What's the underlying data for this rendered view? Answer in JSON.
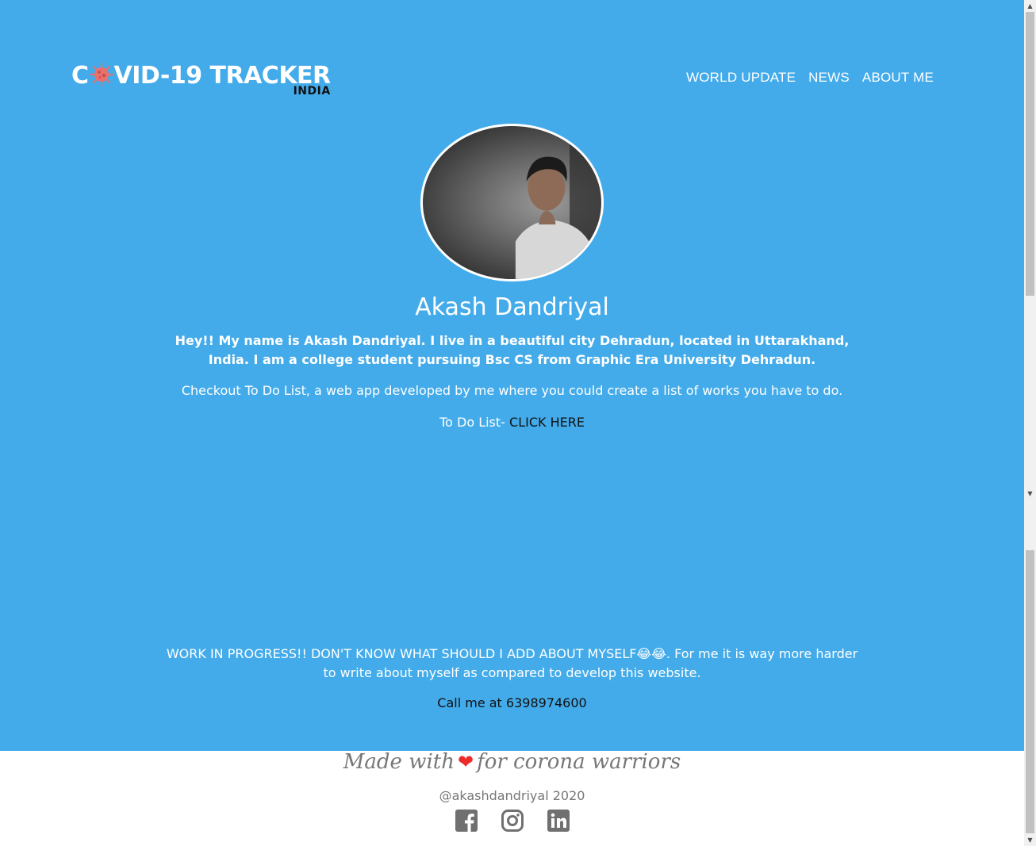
{
  "header": {
    "logo_part1": "C",
    "logo_part2": "VID-19 TRACKER",
    "logo_sub": "INDIA",
    "nav": [
      "WORLD UPDATE",
      "NEWS",
      "ABOUT ME"
    ]
  },
  "profile": {
    "name": "Akash Dandriyal",
    "intro": "Hey!! My name is Akash Dandriyal. I live in a beautiful city Dehradun, located in Uttarakhand, India. I am a college student pursuing Bsc CS from Graphic Era University Dehradun.",
    "checkout": "Checkout To Do List, a web app developed by me where you could create a list of works you have to do.",
    "todo_label": "To Do List- ",
    "todo_link": "CLICK HERE",
    "wip": "WORK IN PROGRESS!! DON'T KNOW WHAT SHOULD I ADD ABOUT MYSELF😂😂. For me it is way more harder to write about myself as compared to develop this website.",
    "call": "Call me at 6398974600"
  },
  "footer": {
    "made_part1": "Made with",
    "heart": "❤",
    "made_part2": "for corona warriors",
    "copyright": "@akashdandriyal 2020",
    "social_icons": [
      "facebook-icon",
      "instagram-icon",
      "linkedin-icon"
    ]
  },
  "colors": {
    "background": "#43abea",
    "heart": "#ee2b2b",
    "footer_text": "#777777"
  }
}
